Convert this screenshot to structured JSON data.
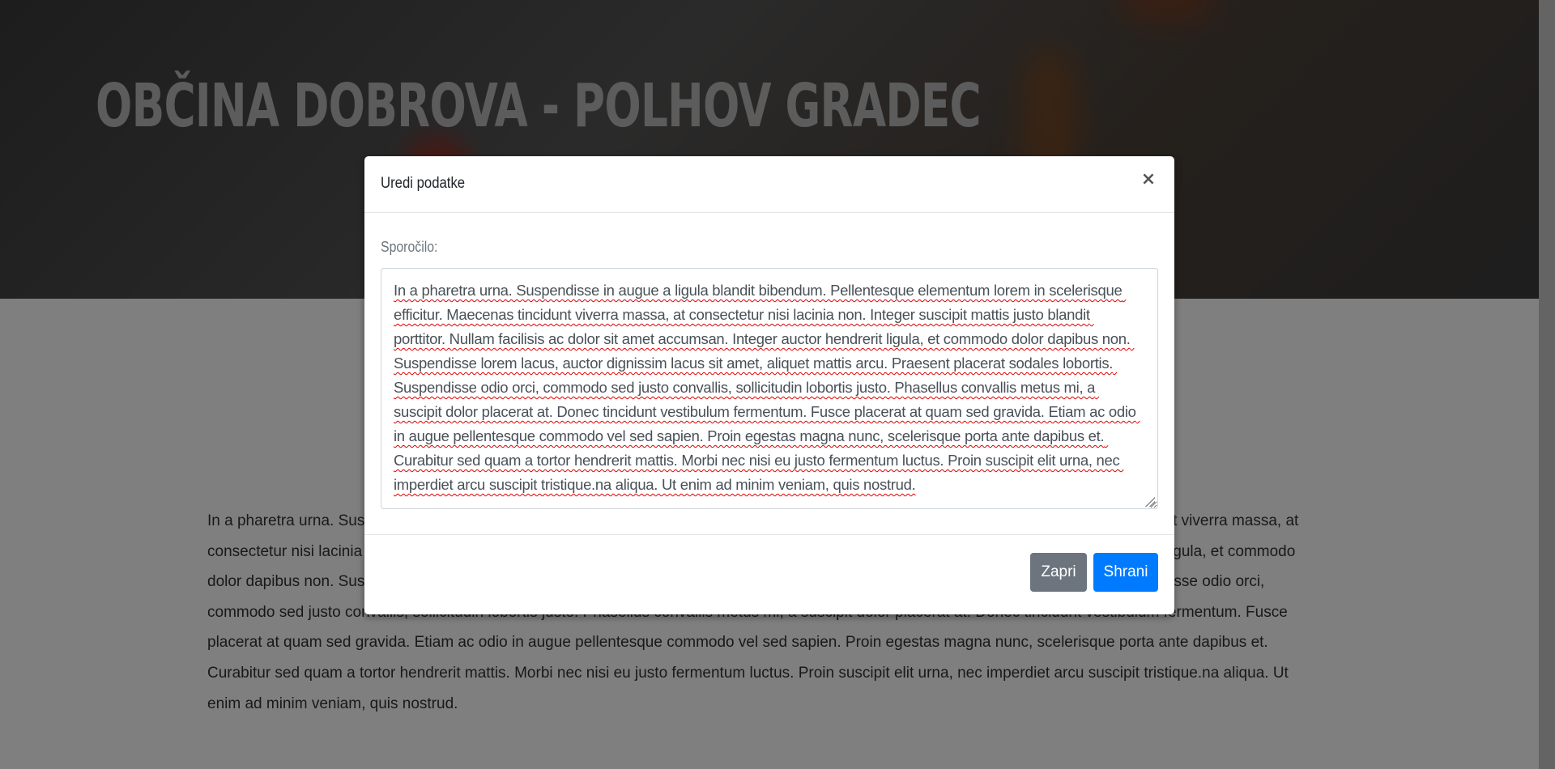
{
  "page": {
    "hero_title": "OBČINA DOBROVA - POLHOV GRADEC",
    "body_text": "In a pharetra urna. Suspendisse in augue a ligula blandit bibendum. Pellentesque elementum lorem in scelerisque efficitur. Maecenas tincidunt viverra massa, at consectetur nisi lacinia non. Integer suscipit mattis justo blandit porttitor. Nullam facilisis ac dolor sit amet accumsan. Integer auctor hendrerit ligula, et commodo dolor dapibus non. Suspendisse lorem lacus, auctor dignissim lacus sit amet, aliquet mattis arcu. Praesent placerat sodales lobortis. Suspendisse odio orci, commodo sed justo convallis, sollicitudin lobortis justo. Phasellus convallis metus mi, a suscipit dolor placerat at. Donec tincidunt vestibulum fermentum. Fusce placerat at quam sed gravida. Etiam ac odio in augue pellentesque commodo vel sed sapien. Proin egestas magna nunc, scelerisque porta ante dapibus et. Curabitur sed quam a tortor hendrerit mattis. Morbi nec nisi eu justo fermentum luctus. Proin suscipit elit urna, nec imperdiet arcu suscipit tristique.na aliqua. Ut enim ad minim veniam, quis nostrud."
  },
  "modal": {
    "title": "Uredi podatke",
    "close_symbol": "×",
    "field_label": "Sporočilo:",
    "message_value": "In a pharetra urna. Suspendisse in augue a ligula blandit bibendum. Pellentesque elementum lorem in scelerisque efficitur. Maecenas tincidunt viverra massa, at consectetur nisi lacinia non. Integer suscipit mattis justo blandit porttitor. Nullam facilisis ac dolor sit amet accumsan. Integer auctor hendrerit ligula, et commodo dolor dapibus non. Suspendisse lorem lacus, auctor dignissim lacus sit amet, aliquet mattis arcu. Praesent placerat sodales lobortis. Suspendisse odio orci, commodo sed justo convallis, sollicitudin lobortis justo. Phasellus convallis metus mi, a suscipit dolor placerat at. Donec tincidunt vestibulum fermentum. Fusce placerat at quam sed gravida. Etiam ac odio in augue pellentesque commodo vel sed sapien. Proin egestas magna nunc, scelerisque porta ante dapibus et. Curabitur sed quam a tortor hendrerit mattis. Morbi nec nisi eu justo fermentum luctus. Proin suscipit elit urna, nec imperdiet arcu suscipit tristique.na aliqua. Ut enim ad minim veniam, quis nostrud.",
    "buttons": {
      "close_label": "Zapri",
      "save_label": "Shrani"
    }
  },
  "colors": {
    "primary": "#007bff",
    "secondary": "#6c757d",
    "backdrop": "rgba(0,0,0,0.5)"
  },
  "icons": {
    "close": "close-icon"
  }
}
